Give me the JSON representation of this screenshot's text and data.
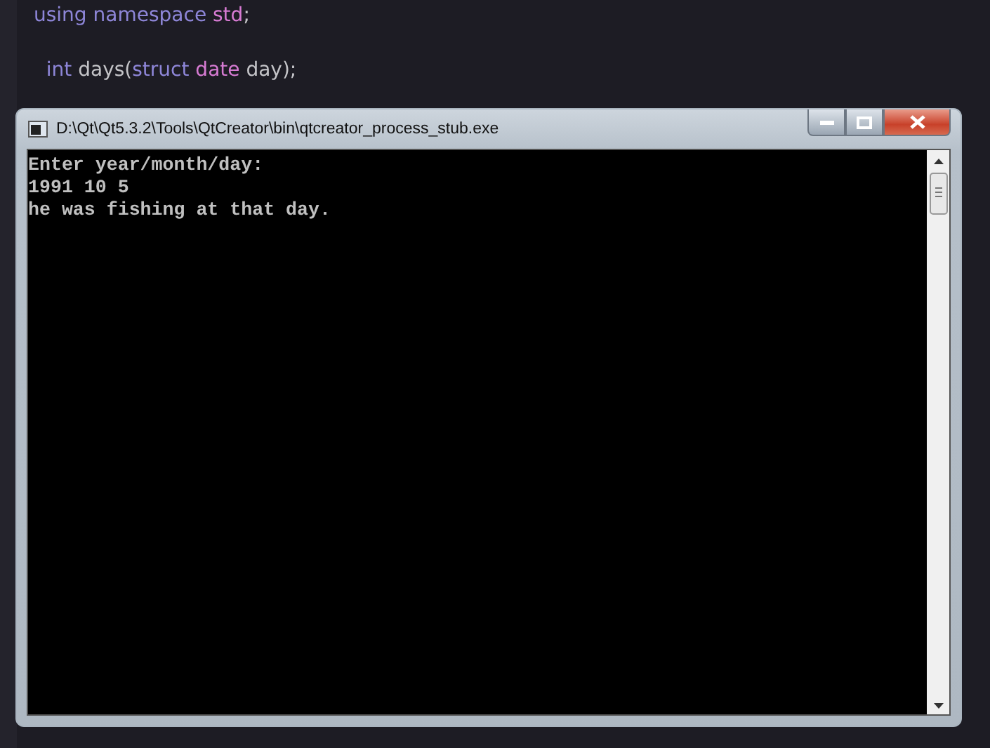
{
  "editor": {
    "lines": [
      {
        "tokens": [
          {
            "text": "using",
            "kind": "keyword"
          },
          {
            "text": " namespace",
            "kind": "keyword"
          },
          {
            "text": " std",
            "kind": "type"
          },
          {
            "text": ";",
            "kind": "plain"
          }
        ]
      },
      {
        "tokens": [
          {
            "text": "  int",
            "kind": "keyword"
          },
          {
            "text": " days(",
            "kind": "plain"
          },
          {
            "text": "struct",
            "kind": "keyword"
          },
          {
            "text": " date",
            "kind": "type"
          },
          {
            "text": " day);",
            "kind": "plain"
          }
        ]
      }
    ]
  },
  "console": {
    "window": {
      "title": "D:\\Qt\\Qt5.3.2\\Tools\\QtCreator\\bin\\qtcreator_process_stub.exe"
    },
    "lines": [
      "Enter year/month/day:",
      "1991 10 5",
      "he was fishing at that day."
    ]
  }
}
